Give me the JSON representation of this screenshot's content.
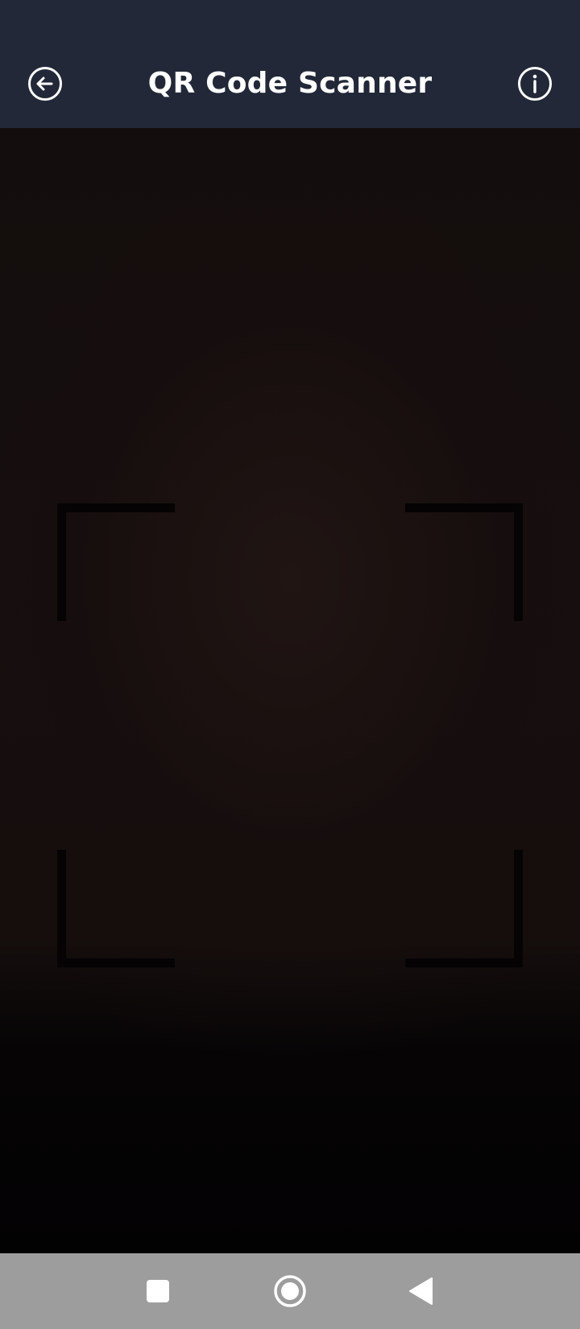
{
  "app_bar": {
    "title": "QR Code Scanner",
    "background_color": "#222838",
    "back_icon": "arrow-left-circle-icon",
    "info_icon": "info-circle-icon"
  },
  "camera_view": {
    "state": "live camera preview (dark)",
    "scan_frame_color": "#050304"
  },
  "nav_bar": {
    "background_color": "#9d9d9d",
    "recents_icon": "square-icon",
    "home_icon": "circle-home-icon",
    "back_icon": "triangle-back-icon"
  }
}
